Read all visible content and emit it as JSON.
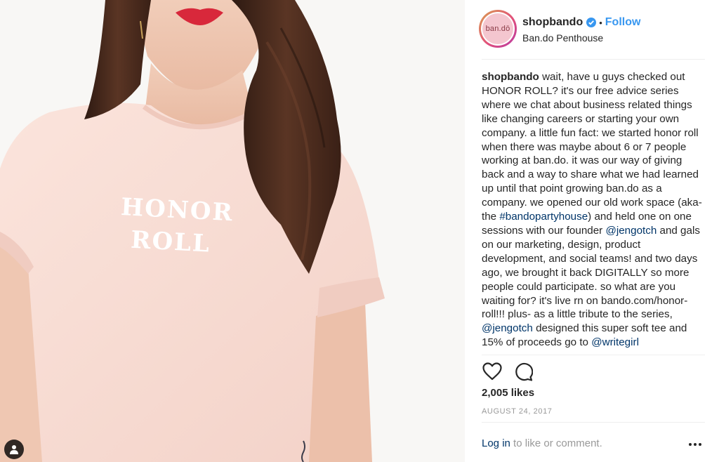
{
  "post": {
    "photo_shirt_text": [
      "HONOR",
      "ROLL"
    ]
  },
  "header": {
    "avatar_text": "ban.dō",
    "username": "shopbando",
    "separator": "•",
    "follow_label": "Follow",
    "location": "Ban.do Penthouse"
  },
  "caption": {
    "username": "shopbando",
    "segments": [
      " wait, have u guys checked out HONOR ROLL? it's our free advice series where we chat about business related things like changing careers or starting your own company. a little fun fact: we started honor roll when there was maybe about 6 or 7 people working at ban.do. it was our way of giving back and a way to share what we had learned up until that point growing ban.do as a company. we opened our old work space (aka-the ",
      "#bandopartyhouse",
      ") and held one on one sessions with our founder ",
      "@jengotch",
      " and gals on our marketing, design, product development, and social teams! and two days ago, we brought it back DIGITALLY so more people could participate. so what are you waiting for? it's live rn on bando.com/honor-roll!!! plus- as a little tribute to the series, ",
      "@jengotch",
      " designed this super soft tee and 15% of proceeds go to ",
      "@writegirl"
    ]
  },
  "stats": {
    "likes": "2,005 likes",
    "date": "AUGUST 24, 2017"
  },
  "footer": {
    "login_link": "Log in",
    "login_suffix": " to like or comment."
  },
  "icons": {
    "like": "heart-icon",
    "comment": "comment-icon",
    "more": "more-options-icon",
    "user_tag": "user-tag-icon",
    "verified": "verified-badge-icon"
  },
  "colors": {
    "accent": "#3897f0",
    "link": "#003569",
    "muted": "#999999",
    "shirt": "#f8dcd4",
    "hair": "#4a2a1c"
  }
}
